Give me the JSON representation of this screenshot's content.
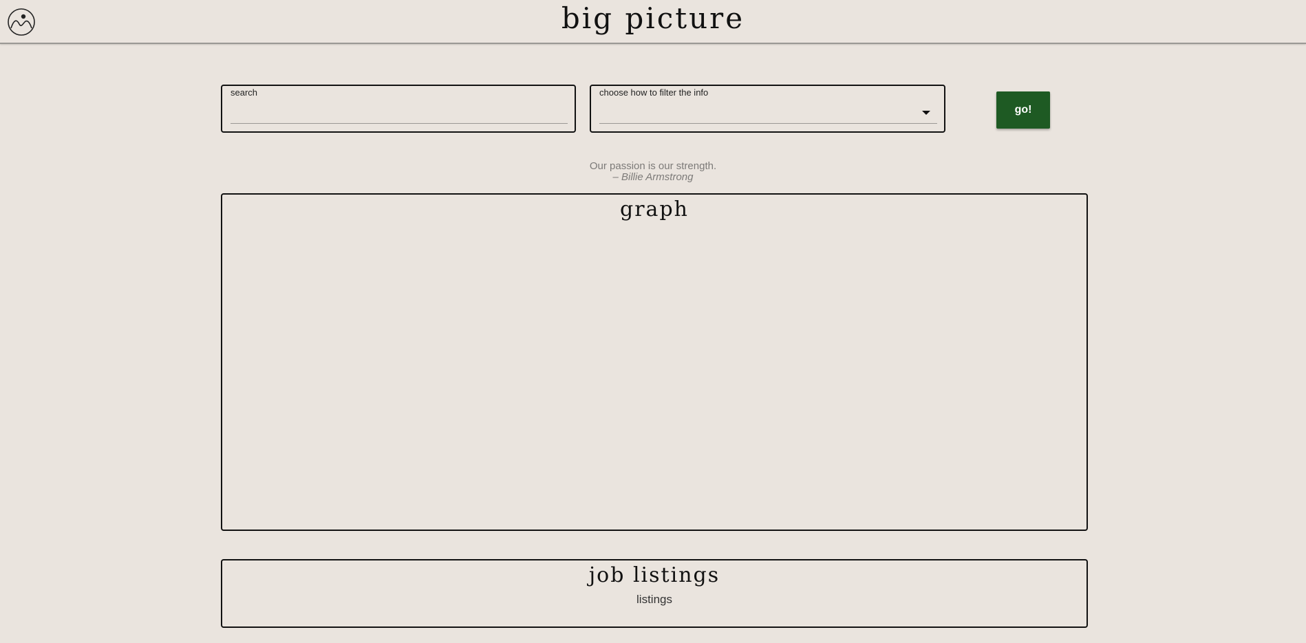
{
  "header": {
    "title": "big picture",
    "logo_icon": "mountain-person-logo-icon"
  },
  "search": {
    "label": "search",
    "value": "",
    "placeholder": ""
  },
  "filter": {
    "label": "choose how to filter the info",
    "selected": "",
    "caret_icon": "caret-down-icon"
  },
  "go_button": {
    "label": "go!"
  },
  "quote": {
    "text": "Our passion is our strength.",
    "author": "– Billie Armstrong"
  },
  "graph_panel": {
    "title": "graph"
  },
  "jobs_panel": {
    "title": "job listings",
    "body": "listings"
  },
  "colors": {
    "background": "#eae4de",
    "button": "#1e5a23",
    "border": "#111111",
    "quote": "#7c7a78"
  }
}
